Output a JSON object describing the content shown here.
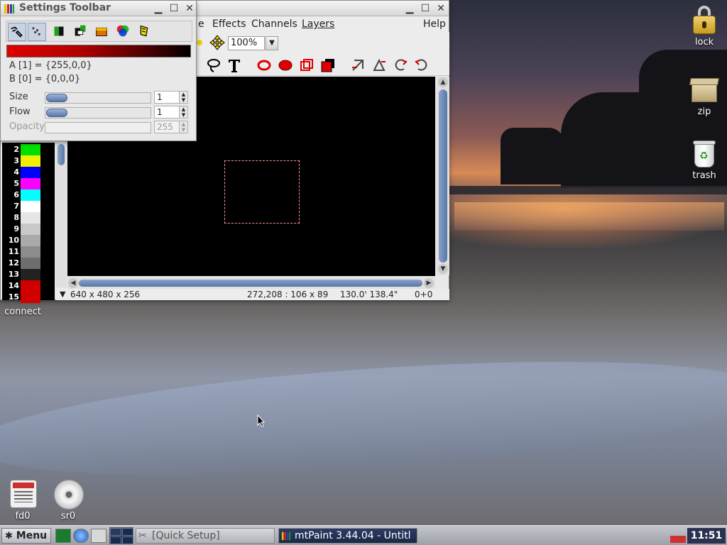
{
  "desktop": {
    "icons": {
      "lock": "lock",
      "zip": "zip",
      "trash": "trash",
      "connect": "connect",
      "fd0": "fd0",
      "sr0": "sr0"
    }
  },
  "mtpaint": {
    "menus": {
      "edit_fragment": "e",
      "effects": "Effects",
      "channels": "Channels",
      "layers": "Layers",
      "help": "Help"
    },
    "zoom": "100%",
    "status": {
      "geometry": "640 x 480 x 256",
      "cursor_selection": "272,208 : 106 x 89",
      "dimensions": "130.0' 138.4\"",
      "offset": "0+0"
    },
    "palette": [
      {
        "index": "2",
        "color": "#00e000"
      },
      {
        "index": "3",
        "color": "#f0f000"
      },
      {
        "index": "4",
        "color": "#0000ff"
      },
      {
        "index": "5",
        "color": "#ff00ff"
      },
      {
        "index": "6",
        "color": "#00ffff"
      },
      {
        "index": "7",
        "color": "#ffffff"
      },
      {
        "index": "8",
        "color": "#e6e6e6"
      },
      {
        "index": "9",
        "color": "#c8c8c8"
      },
      {
        "index": "10",
        "color": "#aaaaaa"
      },
      {
        "index": "11",
        "color": "#8c8c8c"
      },
      {
        "index": "12",
        "color": "#6e6e6e"
      },
      {
        "index": "13",
        "color": "#222222"
      },
      {
        "index": "14",
        "color": "#d00000"
      },
      {
        "index": "15",
        "color": "#d00000"
      }
    ]
  },
  "settings": {
    "title": "Settings Toolbar",
    "color_a": "A [1] = {255,0,0}",
    "color_b": "B [0] = {0,0,0}",
    "size_label": "Size",
    "size_value": "1",
    "flow_label": "Flow",
    "flow_value": "1",
    "opacity_label": "Opacity",
    "opacity_value": "255"
  },
  "taskbar": {
    "menu_label": "Menu",
    "tasks": {
      "quick_setup": "[Quick Setup]",
      "mtpaint": "mtPaint 3.44.04 - Untitl"
    },
    "clock": "11:51"
  },
  "colors": {
    "accent": "#5876a8",
    "canvas": "#000000",
    "selection": "#ff9090",
    "color_a": "#ff0000"
  }
}
